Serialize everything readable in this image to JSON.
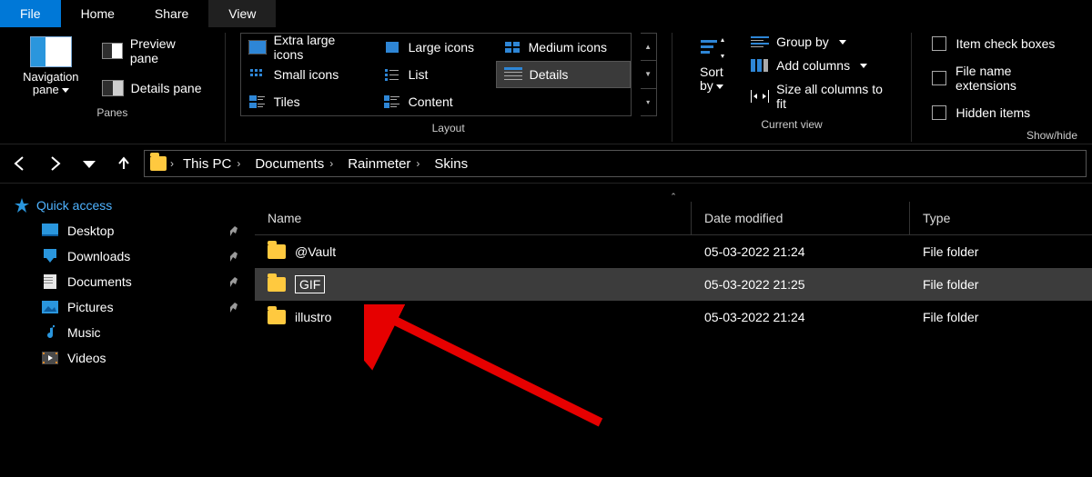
{
  "menu_tabs": {
    "file": "File",
    "home": "Home",
    "share": "Share",
    "view": "View",
    "active": "View"
  },
  "ribbon": {
    "panes": {
      "navigation": "Navigation",
      "pane": "pane",
      "preview_pane": "Preview pane",
      "details_pane": "Details pane",
      "group_label": "Panes"
    },
    "layout": {
      "items": {
        "extra_large_icons": "Extra large icons",
        "large_icons": "Large icons",
        "medium_icons": "Medium icons",
        "small_icons": "Small icons",
        "list": "List",
        "details": "Details",
        "tiles": "Tiles",
        "content": "Content"
      },
      "selected": "details",
      "group_label": "Layout"
    },
    "currentview": {
      "sort_by": "Sort",
      "sort_by2": "by",
      "group_by": "Group by",
      "add_columns": "Add columns",
      "size_all": "Size all columns to fit",
      "group_label": "Current view"
    },
    "showhide": {
      "item_check_boxes": "Item check boxes",
      "file_name_ext": "File name extensions",
      "hidden_items": "Hidden items",
      "group_label": "Show/hide"
    }
  },
  "breadcrumb": [
    "This PC",
    "Documents",
    "Rainmeter",
    "Skins"
  ],
  "sidebar": {
    "quick_access": "Quick access",
    "items": [
      {
        "label": "Desktop",
        "icon": "desktop",
        "pinned": true
      },
      {
        "label": "Downloads",
        "icon": "download",
        "pinned": true
      },
      {
        "label": "Documents",
        "icon": "document",
        "pinned": true
      },
      {
        "label": "Pictures",
        "icon": "picture",
        "pinned": true
      },
      {
        "label": "Music",
        "icon": "music",
        "pinned": false
      },
      {
        "label": "Videos",
        "icon": "video",
        "pinned": false
      }
    ]
  },
  "columns": {
    "name": "Name",
    "date": "Date modified",
    "type": "Type"
  },
  "rows": [
    {
      "name": "@Vault",
      "date": "05-03-2022 21:24",
      "type": "File folder",
      "selected": false,
      "editing": false
    },
    {
      "name": "GIF",
      "date": "05-03-2022 21:25",
      "type": "File folder",
      "selected": true,
      "editing": true
    },
    {
      "name": "illustro",
      "date": "05-03-2022 21:24",
      "type": "File folder",
      "selected": false,
      "editing": false
    }
  ]
}
